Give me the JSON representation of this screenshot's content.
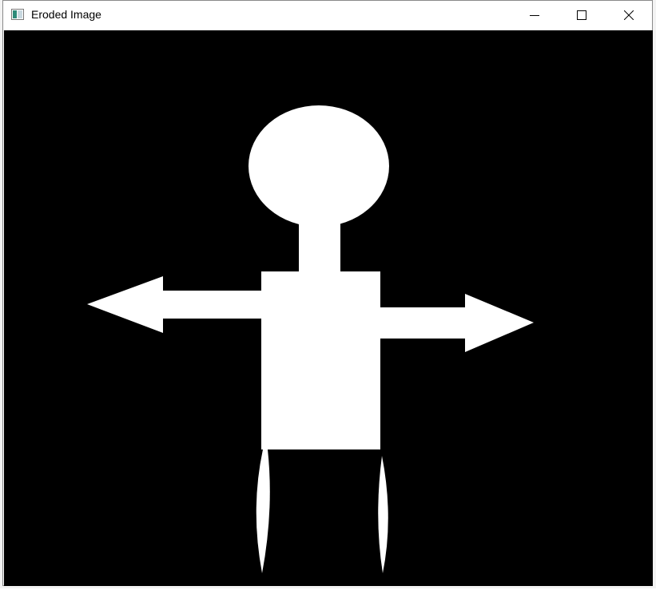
{
  "window": {
    "title": "Eroded Image",
    "app_icon": "opencv-window-icon",
    "controls": {
      "minimize_icon": "minimize-icon",
      "maximize_icon": "maximize-icon",
      "close_icon": "close-icon"
    }
  },
  "image": {
    "description_name": "eroded-binary-figure",
    "background_color": "#000000",
    "foreground_color": "#ffffff"
  },
  "colors": {
    "titlebar": "#ffffff",
    "border": "#8a8a8a"
  }
}
